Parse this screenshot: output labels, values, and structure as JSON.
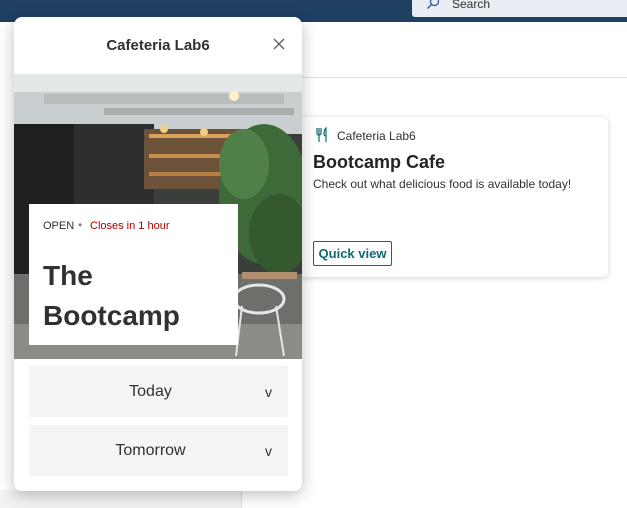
{
  "search": {
    "placeholder": "Search"
  },
  "card": {
    "app_name": "Cafeteria Lab6",
    "title": "Bootcamp Cafe",
    "description": "Check out what delicious food is available today!",
    "button_label": "Quick view"
  },
  "panel": {
    "title": "Cafeteria Lab6",
    "status": "OPEN",
    "separator": "•",
    "closes_text": "Closes in 1 hour",
    "venue_name": "The Bootcamp",
    "sections": [
      {
        "label": "Today",
        "chevron": "v"
      },
      {
        "label": "Tomorrow",
        "chevron": "v"
      }
    ]
  },
  "colors": {
    "accent": "#0f6b73",
    "closing_text": "#a80000",
    "topbar": "#1f3f63"
  },
  "icons": {
    "search": "search-icon",
    "close": "close-icon",
    "utensils": "fork-knife-icon"
  }
}
